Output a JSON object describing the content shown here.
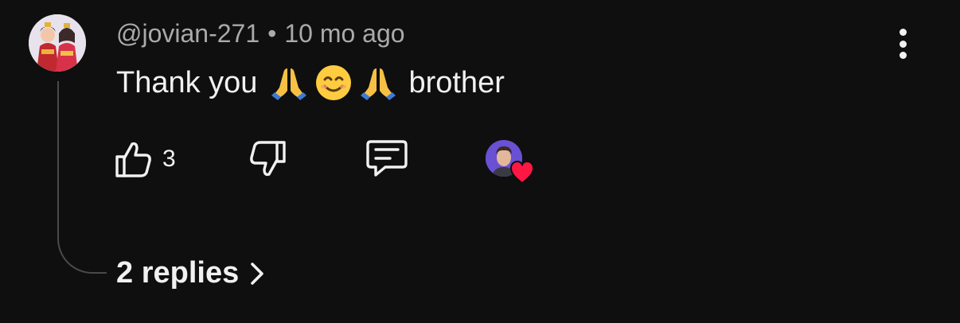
{
  "comment": {
    "author": "@jovian-271",
    "separator": "•",
    "timestamp": "10 mo ago",
    "text_before": "Thank you",
    "emojis": [
      "folded-hands",
      "smiling-face",
      "folded-hands"
    ],
    "text_after": "brother",
    "like_count": "3",
    "hearted_by_creator": true
  },
  "replies": {
    "label": "2 replies"
  },
  "colors": {
    "background": "#0f0f0f",
    "text": "#f1f1f1",
    "meta": "#aaaaaa",
    "heart": "#ff1744"
  }
}
